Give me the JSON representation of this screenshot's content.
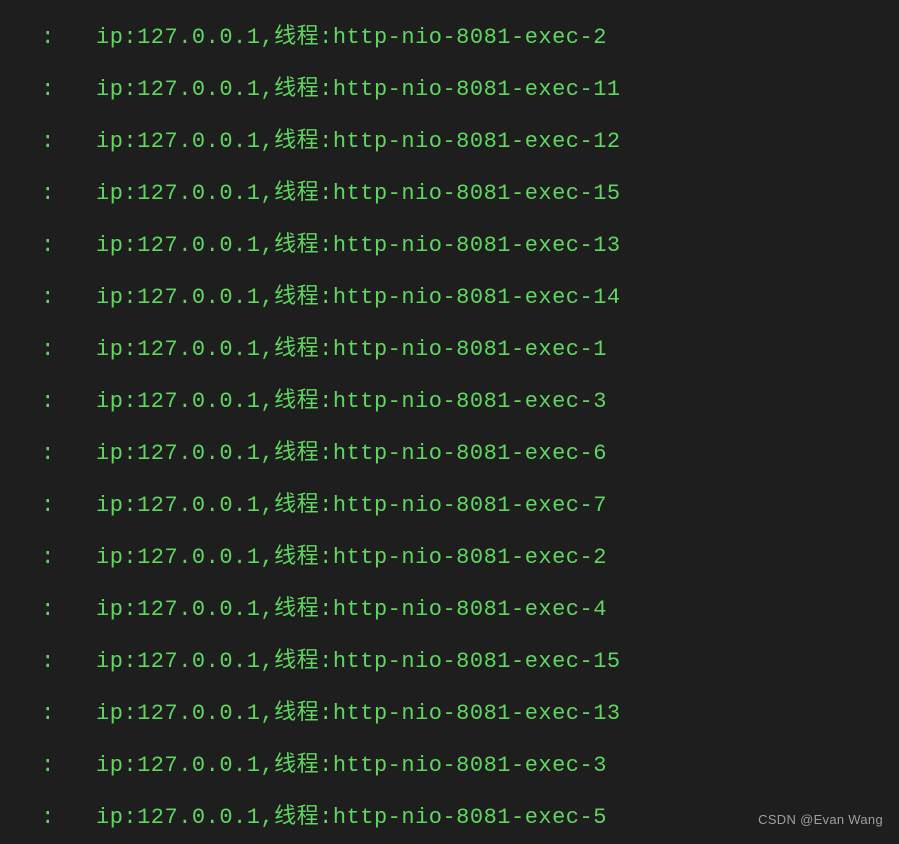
{
  "logs": [
    {
      "prefix": ":",
      "ip": "127.0.0.1",
      "thread_label": "线程",
      "thread": "http-nio-8081-exec-2"
    },
    {
      "prefix": ":",
      "ip": "127.0.0.1",
      "thread_label": "线程",
      "thread": "http-nio-8081-exec-11"
    },
    {
      "prefix": ":",
      "ip": "127.0.0.1",
      "thread_label": "线程",
      "thread": "http-nio-8081-exec-12"
    },
    {
      "prefix": ":",
      "ip": "127.0.0.1",
      "thread_label": "线程",
      "thread": "http-nio-8081-exec-15"
    },
    {
      "prefix": ":",
      "ip": "127.0.0.1",
      "thread_label": "线程",
      "thread": "http-nio-8081-exec-13"
    },
    {
      "prefix": ":",
      "ip": "127.0.0.1",
      "thread_label": "线程",
      "thread": "http-nio-8081-exec-14"
    },
    {
      "prefix": ":",
      "ip": "127.0.0.1",
      "thread_label": "线程",
      "thread": "http-nio-8081-exec-1"
    },
    {
      "prefix": ":",
      "ip": "127.0.0.1",
      "thread_label": "线程",
      "thread": "http-nio-8081-exec-3"
    },
    {
      "prefix": ":",
      "ip": "127.0.0.1",
      "thread_label": "线程",
      "thread": "http-nio-8081-exec-6"
    },
    {
      "prefix": ":",
      "ip": "127.0.0.1",
      "thread_label": "线程",
      "thread": "http-nio-8081-exec-7"
    },
    {
      "prefix": ":",
      "ip": "127.0.0.1",
      "thread_label": "线程",
      "thread": "http-nio-8081-exec-2"
    },
    {
      "prefix": ":",
      "ip": "127.0.0.1",
      "thread_label": "线程",
      "thread": "http-nio-8081-exec-4"
    },
    {
      "prefix": ":",
      "ip": "127.0.0.1",
      "thread_label": "线程",
      "thread": "http-nio-8081-exec-15"
    },
    {
      "prefix": ":",
      "ip": "127.0.0.1",
      "thread_label": "线程",
      "thread": "http-nio-8081-exec-13"
    },
    {
      "prefix": ":",
      "ip": "127.0.0.1",
      "thread_label": "线程",
      "thread": "http-nio-8081-exec-3"
    },
    {
      "prefix": ":",
      "ip": "127.0.0.1",
      "thread_label": "线程",
      "thread": "http-nio-8081-exec-5"
    }
  ],
  "watermark": "CSDN @Evan Wang"
}
